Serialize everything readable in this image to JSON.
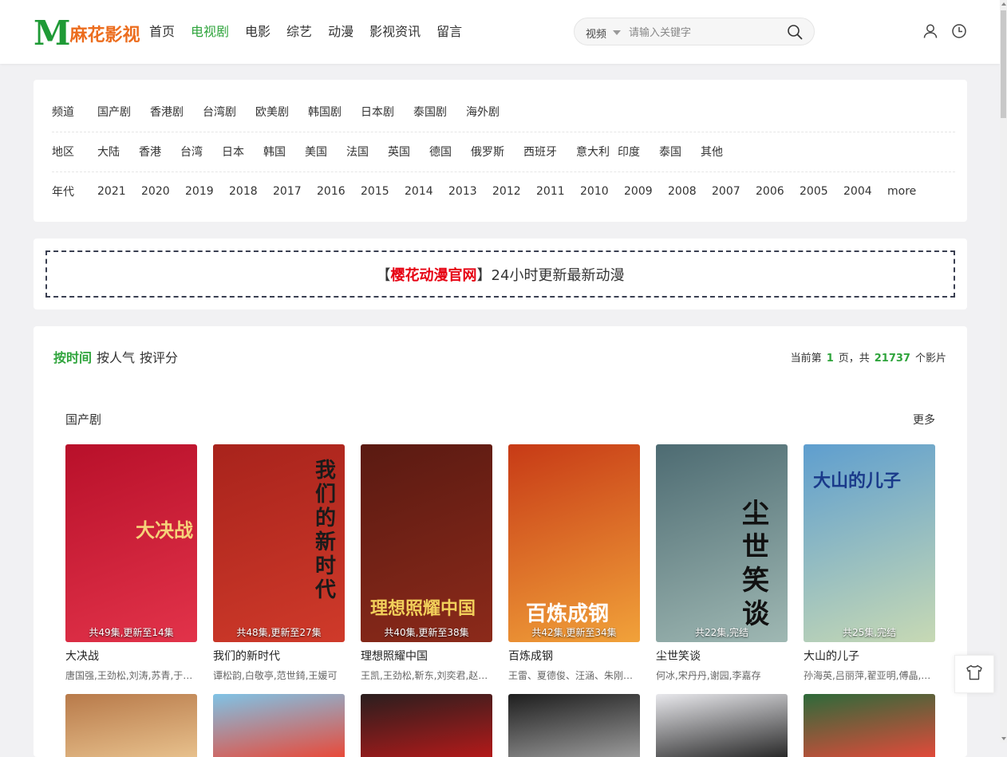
{
  "logo": {
    "mark": "M",
    "text": "麻花影视"
  },
  "nav": [
    "首页",
    "电视剧",
    "电影",
    "综艺",
    "动漫",
    "影视资讯",
    "留言"
  ],
  "nav_active_index": 1,
  "search": {
    "type": "视频",
    "placeholder": "请输入关键字"
  },
  "header_icons": [
    "user-icon",
    "history-icon"
  ],
  "filters": {
    "channel": {
      "label": "频道",
      "options": [
        "国产剧",
        "香港剧",
        "台湾剧",
        "欧美剧",
        "韩国剧",
        "日本剧",
        "泰国剧",
        "海外剧"
      ]
    },
    "region": {
      "label": "地区",
      "options": [
        "大陆",
        "香港",
        "台湾",
        "日本",
        "韩国",
        "美国",
        "法国",
        "英国",
        "德国",
        "俄罗斯",
        "西班牙",
        "意大利",
        "印度",
        "泰国",
        "其他"
      ]
    },
    "year": {
      "label": "年代",
      "options": [
        "2021",
        "2020",
        "2019",
        "2018",
        "2017",
        "2016",
        "2015",
        "2014",
        "2013",
        "2012",
        "2011",
        "2010",
        "2009",
        "2008",
        "2007",
        "2006",
        "2005",
        "2004",
        "more"
      ]
    }
  },
  "banner": {
    "open": "【",
    "highlight": "樱花动漫官网",
    "close": "】",
    "text": "24小时更新最新动漫"
  },
  "sort": {
    "options": [
      "按时间",
      "按人气",
      "按评分"
    ],
    "active_index": 0
  },
  "page_info": {
    "prefix": "当前第",
    "page": "1",
    "mid": "页，共",
    "total": "21737",
    "suffix": "个影片"
  },
  "section": {
    "title": "国产剧",
    "more": "更多"
  },
  "items": [
    {
      "name": "大决战",
      "actors": "唐国强,王劲松,刘涛,苏青,于和伟",
      "episodes": "共49集,更新至14集",
      "poster_title": "大决战",
      "colors": [
        "#b8102a",
        "#e2334a"
      ]
    },
    {
      "name": "我们的新时代",
      "actors": "谭松韵,白敬亭,范世錡,王媛可",
      "episodes": "共48集,更新至27集",
      "poster_title": "我们的新时代",
      "colors": [
        "#a8231c",
        "#cf3a2a"
      ]
    },
    {
      "name": "理想照耀中国",
      "actors": "王凯,王劲松,靳东,刘奕君,赵丽颖",
      "episodes": "共40集,更新至38集",
      "poster_title": "理想照耀中国",
      "colors": [
        "#5a1a12",
        "#8c2a1a"
      ]
    },
    {
      "name": "百炼成钢",
      "actors": "王雷、夏德俊、汪涵、朱刚日尧",
      "episodes": "共42集,更新至34集",
      "poster_title": "百炼成钢",
      "colors": [
        "#c73a16",
        "#f1a23a"
      ]
    },
    {
      "name": "尘世笑谈",
      "actors": "何冰,宋丹丹,谢园,李嘉存",
      "episodes": "共22集,完结",
      "poster_title": "尘世笑谈",
      "colors": [
        "#4d6b72",
        "#9fb8b3"
      ]
    },
    {
      "name": "大山的儿子",
      "actors": "孙海英,吕丽萍,翟亚明,傅晶,王奎荣",
      "episodes": "共25集,完结",
      "poster_title": "大山的儿子",
      "colors": [
        "#5e9ecf",
        "#c7d9b4"
      ]
    }
  ],
  "second_row_colors": [
    [
      "#b87a4a",
      "#e7c08c"
    ],
    [
      "#7fc3e6",
      "#e84a3a"
    ],
    [
      "#2a1e1e",
      "#b31a1a"
    ],
    [
      "#1e1e1e",
      "#9a9a9a"
    ],
    [
      "#e8e8ec",
      "#2a2a2a"
    ],
    [
      "#2d6a3a",
      "#e14a3a"
    ]
  ]
}
